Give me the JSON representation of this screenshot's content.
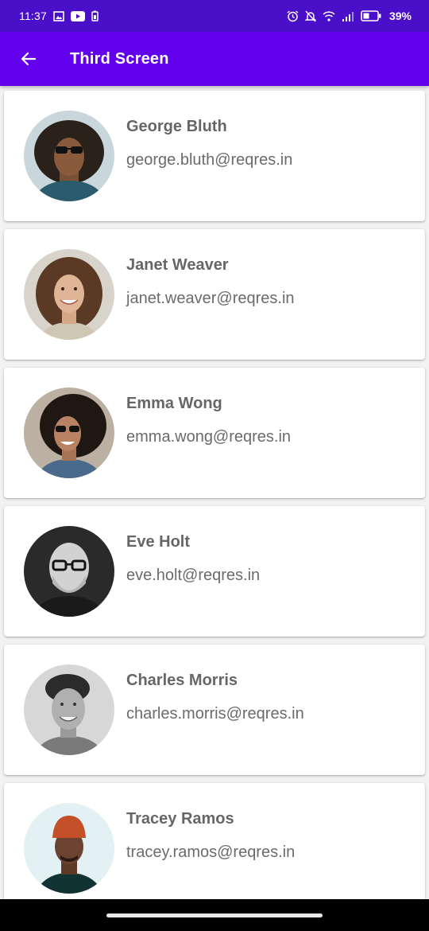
{
  "status_bar": {
    "time": "11:37",
    "battery": "39%",
    "left_icons": [
      "image-icon",
      "youtube-icon",
      "battery-saver-icon"
    ],
    "right_icons": [
      "alarm-icon",
      "mute-icon",
      "wifi-icon",
      "signal-icon",
      "battery-icon"
    ]
  },
  "app_bar": {
    "title": "Third Screen",
    "color": "#6200ee"
  },
  "users": [
    {
      "name": "George Bluth",
      "email": "george.bluth@reqres.in"
    },
    {
      "name": "Janet Weaver",
      "email": "janet.weaver@reqres.in"
    },
    {
      "name": "Emma Wong",
      "email": "emma.wong@reqres.in"
    },
    {
      "name": "Eve Holt",
      "email": "eve.holt@reqres.in"
    },
    {
      "name": "Charles Morris",
      "email": "charles.morris@reqres.in"
    },
    {
      "name": "Tracey Ramos",
      "email": "tracey.ramos@reqres.in"
    }
  ]
}
